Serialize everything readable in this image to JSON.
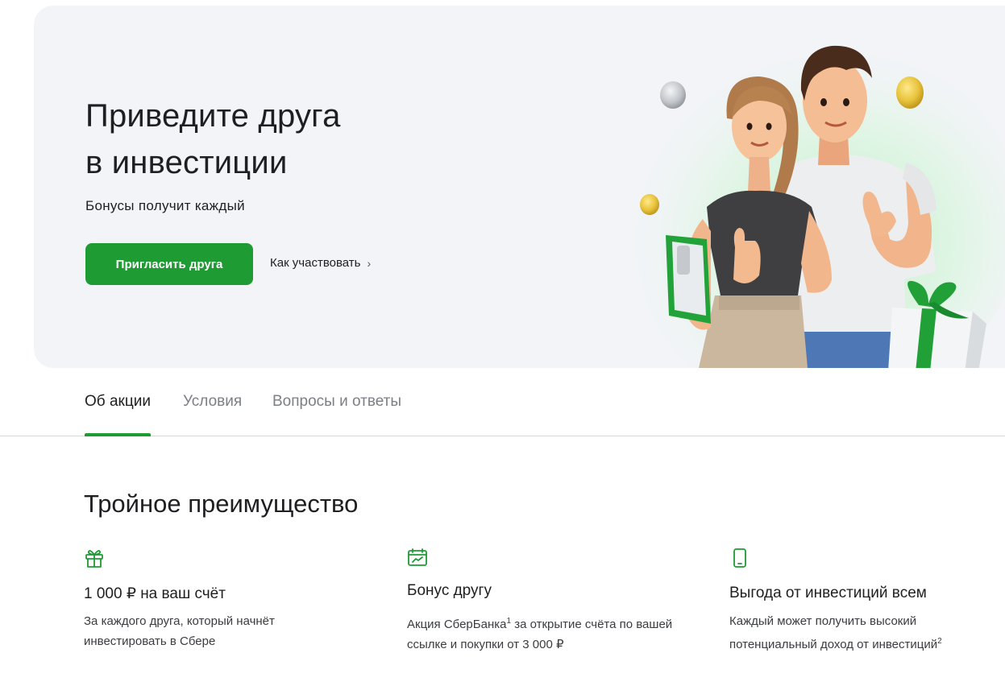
{
  "hero": {
    "title_line1": "Приведите друга",
    "title_line2": "в инвестиции",
    "subtitle": "Бонусы получит каждый",
    "primary_button": "Пригласить друга",
    "secondary_link": "Как участвовать",
    "secondary_link_chevron": "›"
  },
  "tabs": [
    {
      "label": "Об акции",
      "active": true
    },
    {
      "label": "Условия",
      "active": false
    },
    {
      "label": "Вопросы и ответы",
      "active": false
    }
  ],
  "benefits": {
    "title": "Тройное преимущество",
    "items": [
      {
        "icon": "gift-icon",
        "title": "1 000 ₽ на ваш счёт",
        "text_line1": "За каждого друга, который начнёт",
        "text_line2": "инвестировать в Сбере"
      },
      {
        "icon": "calendar-chart-icon",
        "title": "Бонус другу",
        "text_line1_a": "Акция СберБанка",
        "text_line1_sup": "1",
        "text_line1_b": " за открытие счёта по вашей",
        "text_line2": "ссылке и покупки от 3 000 ₽"
      },
      {
        "icon": "smartphone-icon",
        "title": "Выгода от инвестиций всем",
        "text_line1": "Каждый может получить высокий",
        "text_line2_a": "потенциальный доход от инвестиций",
        "text_line2_sup": "2"
      }
    ]
  },
  "colors": {
    "accent": "#1e9b33",
    "hero_bg": "#f2f4f7"
  }
}
